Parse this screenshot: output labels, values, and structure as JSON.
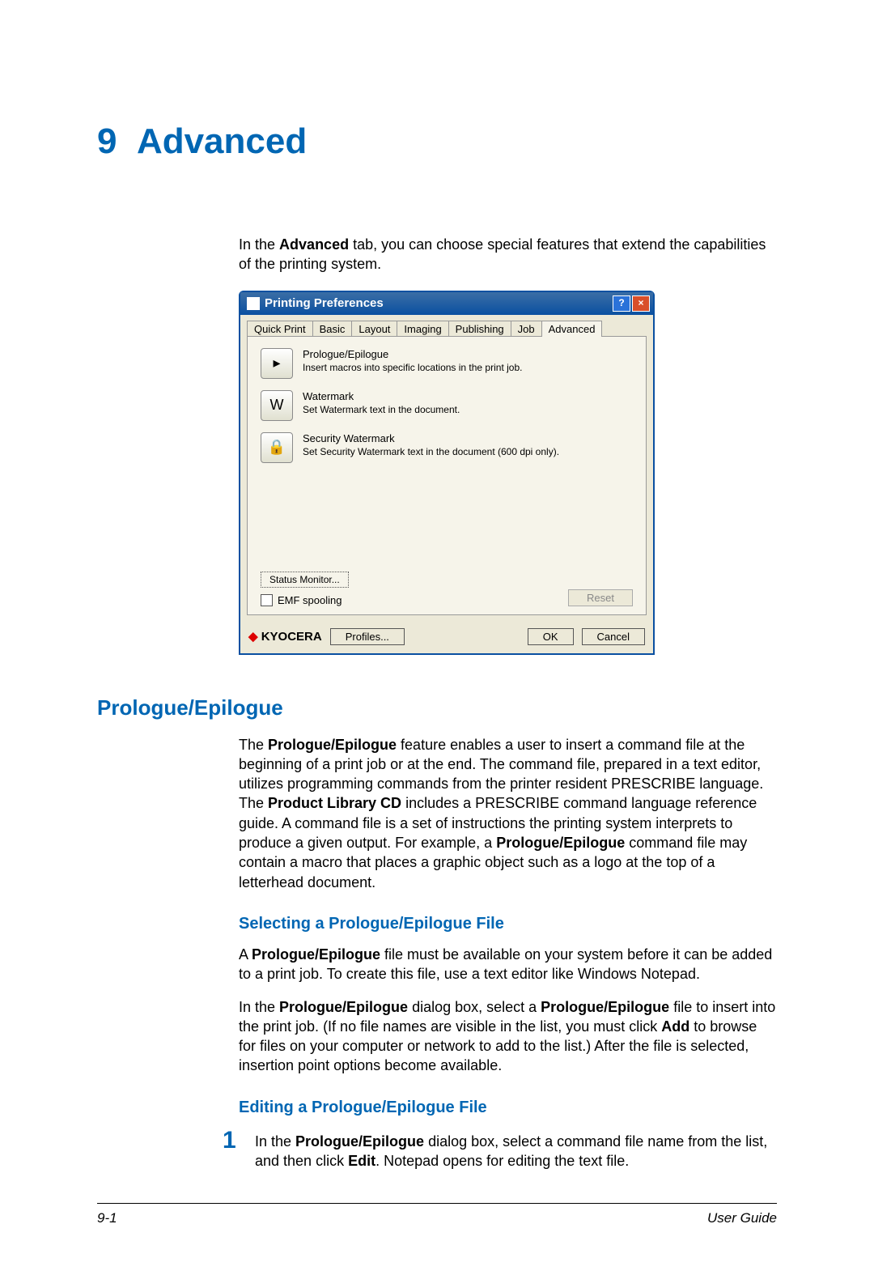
{
  "chapter": {
    "number": "9",
    "title": "Advanced"
  },
  "intro": {
    "pre": "In the ",
    "bold": "Advanced",
    "post": " tab, you can choose special features that extend the capabilities of the printing system."
  },
  "dialog": {
    "title": "Printing Preferences",
    "tabs": {
      "t0": "Quick Print",
      "t1": "Basic",
      "t2": "Layout",
      "t3": "Imaging",
      "t4": "Publishing",
      "t5": "Job",
      "t6": "Advanced"
    },
    "options": {
      "o0": {
        "title": "Prologue/Epilogue",
        "desc": "Insert macros into specific locations in the print job.",
        "glyph": "▸"
      },
      "o1": {
        "title": "Watermark",
        "desc": "Set Watermark text in the document.",
        "glyph": "W"
      },
      "o2": {
        "title": "Security Watermark",
        "desc": "Set Security Watermark text in the document (600 dpi only).",
        "glyph": "🔒"
      }
    },
    "status_monitor": "Status Monitor...",
    "emf_spooling": "EMF spooling",
    "reset": "Reset",
    "logo": "KYOCERA",
    "profiles": "Profiles...",
    "ok": "OK",
    "cancel": "Cancel"
  },
  "section1": {
    "heading": "Prologue/Epilogue",
    "p1_a": "The ",
    "p1_b": "Prologue/Epilogue",
    "p1_c": " feature enables a user to insert a command file at the beginning of a print job or at the end. The command file, prepared in a text editor, utilizes programming commands from the printer resident PRESCRIBE language. The ",
    "p1_d": "Product Library CD",
    "p1_e": " includes a PRESCRIBE command language reference guide. A command file is a set of instructions the printing system interprets to produce a given output. For example, a ",
    "p1_f": "Prologue/Epilogue",
    "p1_g": " command file may contain a macro that places a graphic object such as a logo at the top of a letterhead document."
  },
  "section2": {
    "heading": "Selecting a Prologue/Epilogue File",
    "p1_a": "A ",
    "p1_b": "Prologue/Epilogue",
    "p1_c": " file must be available on your system before it can be added to a print job. To create this file, use a text editor like Windows Notepad.",
    "p2_a": "In the ",
    "p2_b": "Prologue/Epilogue",
    "p2_c": " dialog box, select a ",
    "p2_d": "Prologue/Epilogue",
    "p2_e": " file to insert into the print job. (If no file names are visible in the list, you must click ",
    "p2_f": "Add",
    "p2_g": " to browse for files on your computer or network to add to the list.) After the file is selected, insertion point options become available."
  },
  "section3": {
    "heading": "Editing a Prologue/Epilogue File",
    "step1_num": "1",
    "step1_a": "In the ",
    "step1_b": "Prologue/Epilogue",
    "step1_c": " dialog box, select a command file name from the list, and then click ",
    "step1_d": "Edit",
    "step1_e": ". Notepad opens for editing the text file."
  },
  "footer": {
    "page": "9-1",
    "guide": "User Guide"
  }
}
